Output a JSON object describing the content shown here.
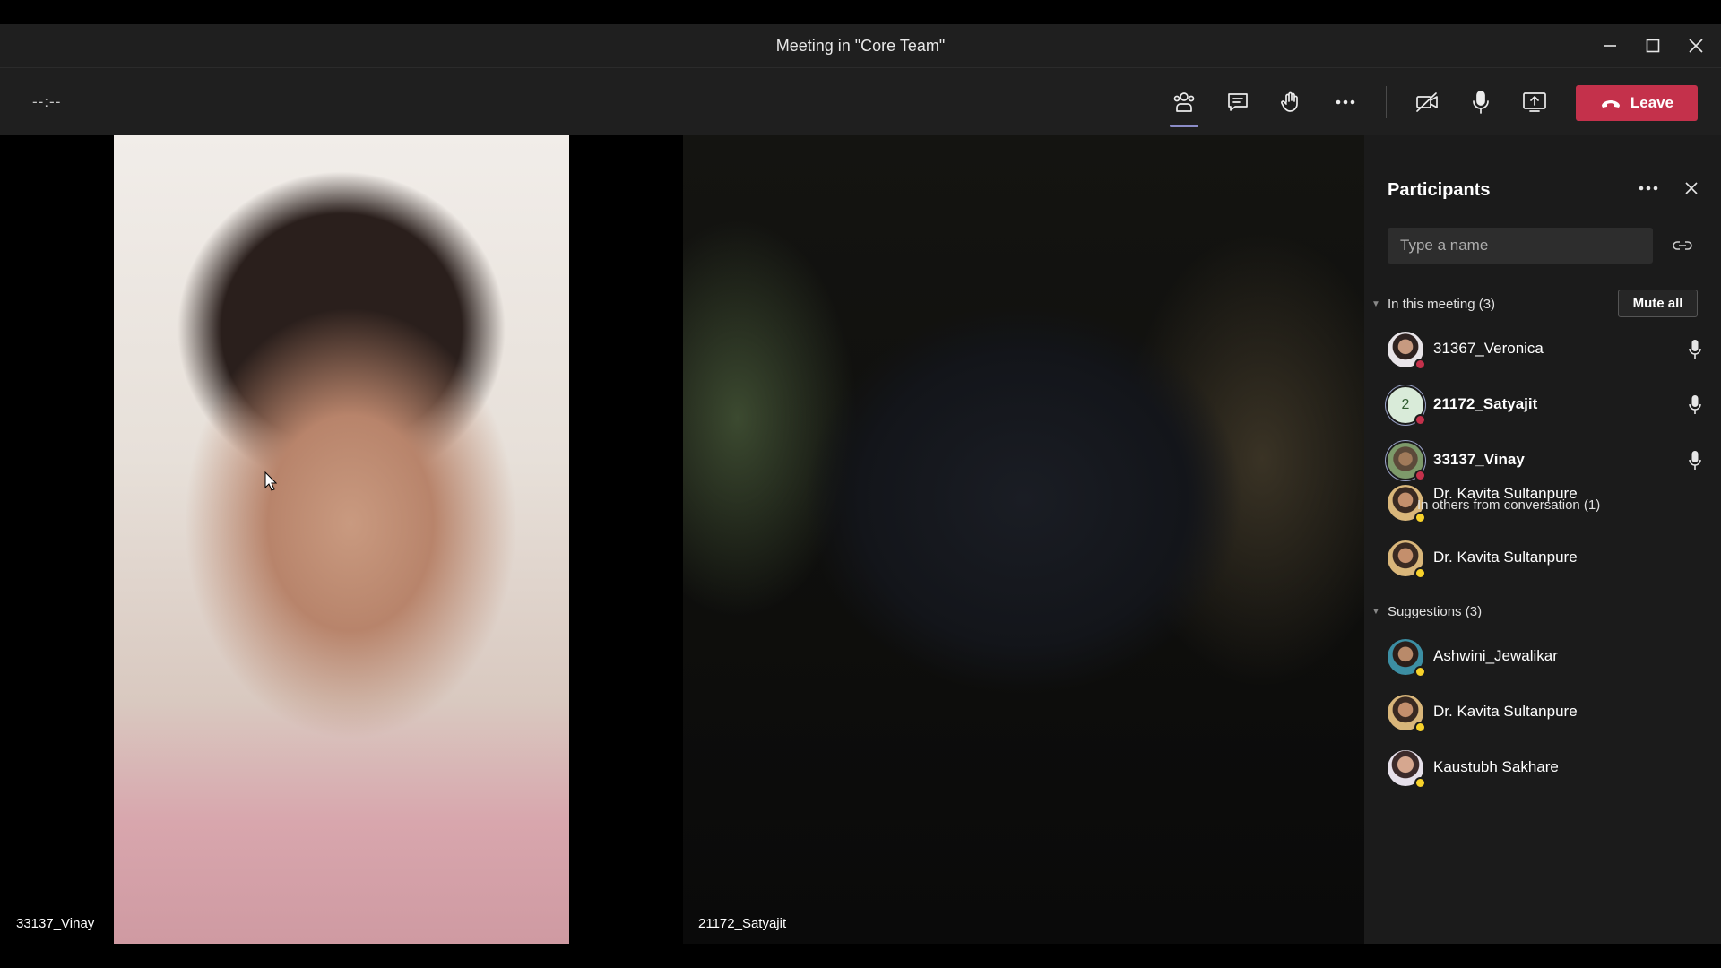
{
  "window": {
    "title": "Meeting in \"Core Team\"",
    "minimize_icon": "minimize-icon",
    "maximize_icon": "maximize-icon",
    "close_icon": "close-icon"
  },
  "toolbar": {
    "timer": "--:--",
    "buttons": [
      {
        "name": "participants",
        "icon": "people-icon",
        "active": true
      },
      {
        "name": "chat",
        "icon": "chat-icon"
      },
      {
        "name": "raise-hand",
        "icon": "hand-icon"
      },
      {
        "name": "more-actions",
        "icon": "more-icon"
      },
      {
        "name": "camera",
        "icon": "camera-off-icon"
      },
      {
        "name": "mic",
        "icon": "microphone-icon"
      },
      {
        "name": "share",
        "icon": "share-screen-icon"
      }
    ],
    "leave_label": "Leave",
    "leave_color": "#c4314b",
    "accent_color": "#8b8cc7"
  },
  "videos": [
    {
      "name": "33137_Vinay"
    },
    {
      "name": "21172_Satyajit"
    }
  ],
  "panel": {
    "title": "Participants",
    "search_placeholder": "Type a name",
    "in_meeting": {
      "label": "In this meeting (3)",
      "mute_all_label": "Mute all",
      "participants": [
        {
          "name": "31367_Veronica",
          "avatar": "photo",
          "status": "busy",
          "mic": true
        },
        {
          "name": "21172_Satyajit",
          "avatar": "initial",
          "initial": "2",
          "status": "busy",
          "mic": true
        },
        {
          "name": "33137_Vinay",
          "avatar": "photo",
          "status": "busy",
          "mic": true
        }
      ]
    },
    "overlap_ghost": {
      "name": "Dr. Kavita Sultanpure",
      "label": "In others from conversation (1)"
    },
    "others": {
      "participants": [
        {
          "name": "Dr. Kavita Sultanpure",
          "status": "away"
        }
      ]
    },
    "suggestions": {
      "label": "Suggestions (3)",
      "participants": [
        {
          "name": "Ashwini_Jewalikar",
          "status": "away"
        },
        {
          "name": "Dr. Kavita Sultanpure",
          "status": "away"
        },
        {
          "name": "Kaustubh Sakhare",
          "status": "away"
        }
      ]
    },
    "status_colors": {
      "busy": "#c4314b",
      "away": "#f8d22a"
    }
  }
}
